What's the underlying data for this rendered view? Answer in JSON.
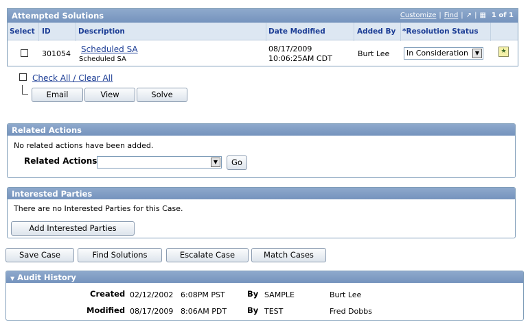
{
  "attempted_solutions": {
    "title": "Attempted Solutions",
    "nav": {
      "customize": "Customize",
      "find": "Find",
      "count": "1 of 1"
    },
    "columns": [
      "Select",
      "ID",
      "Description",
      "Date Modified",
      "Added By",
      "*Resolution Status"
    ],
    "rows": [
      {
        "id": "301054",
        "description_link": "Scheduled SA",
        "description_text": "Scheduled SA",
        "date_line1": "08/17/2009",
        "date_line2": "10:06:25AM CDT",
        "added_by": "Burt Lee",
        "status": "In Consideration"
      }
    ],
    "check_all": "Check All / Clear All",
    "buttons": {
      "email": "Email",
      "view": "View",
      "solve": "Solve"
    }
  },
  "related_actions": {
    "title": "Related Actions",
    "message": "No related actions have been added.",
    "label": "Related Actions",
    "go": "Go"
  },
  "interested_parties": {
    "title": "Interested Parties",
    "message": "There are no Interested Parties for this Case.",
    "add_button": "Add Interested Parties"
  },
  "actions": {
    "save": "Save Case",
    "find": "Find Solutions",
    "escalate": "Escalate Case",
    "match": "Match Cases"
  },
  "audit": {
    "title": "Audit History",
    "by_label": "By",
    "rows": [
      {
        "label": "Created",
        "date": "02/12/2002",
        "time": "6:08PM PST",
        "by": "SAMPLE",
        "name": "Burt Lee"
      },
      {
        "label": "Modified",
        "date": "08/17/2009",
        "time": "8:06AM PDT",
        "by": "TEST",
        "name": "Fred Dobbs"
      }
    ]
  }
}
